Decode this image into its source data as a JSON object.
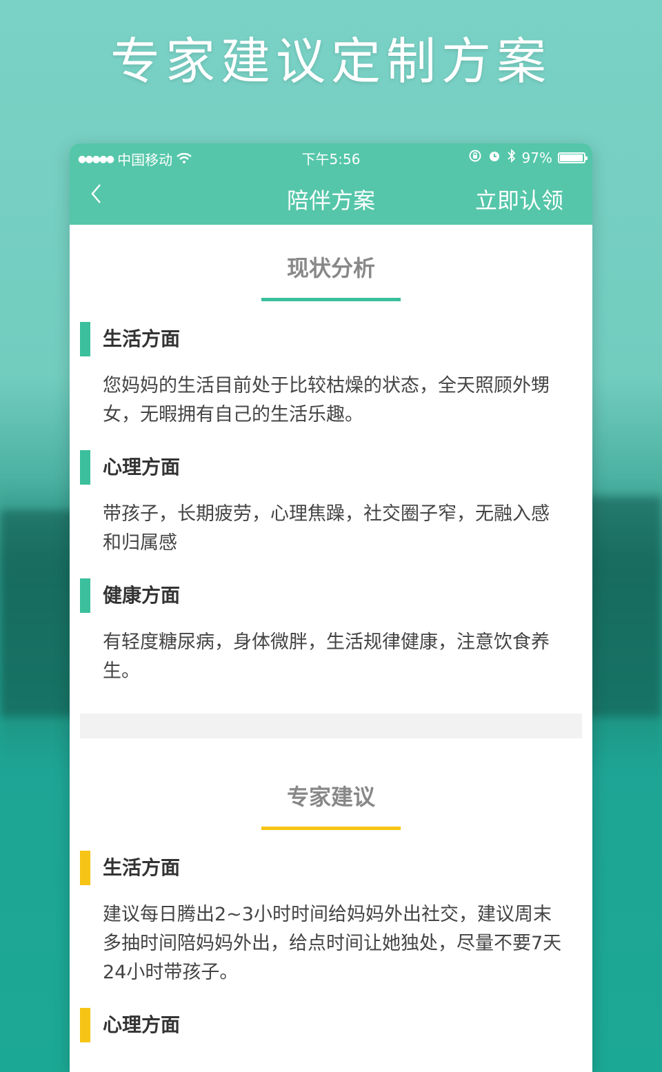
{
  "promo": {
    "title": "专家建议定制方案"
  },
  "statusbar": {
    "carrier": "中国移动",
    "time": "下午5:56",
    "battery": "97%",
    "battery_level": 0.97
  },
  "navbar": {
    "back": "‹",
    "title": "陪伴方案",
    "action": "立即认领"
  },
  "analysis": {
    "title": "现状分析",
    "accent": "#3bbf9c",
    "items": [
      {
        "heading": "生活方面",
        "text": "您妈妈的生活目前处于比较枯燥的状态，全天照顾外甥女，无暇拥有自己的生活乐趣。"
      },
      {
        "heading": "心理方面",
        "text": "带孩子，长期疲劳，心理焦躁，社交圈子窄，无融入感和归属感"
      },
      {
        "heading": "健康方面",
        "text": "有轻度糖尿病，身体微胖，生活规律健康，注意饮食养生。"
      }
    ]
  },
  "advice": {
    "title": "专家建议",
    "accent": "#f6c414",
    "items": [
      {
        "heading": "生活方面",
        "text": "建议每日腾出2~3小时时间给妈妈外出社交，建议周末多抽时间陪妈妈外出，给点时间让她独处，尽量不要7天24小时带孩子。"
      },
      {
        "heading": "心理方面",
        "text": ""
      }
    ]
  }
}
